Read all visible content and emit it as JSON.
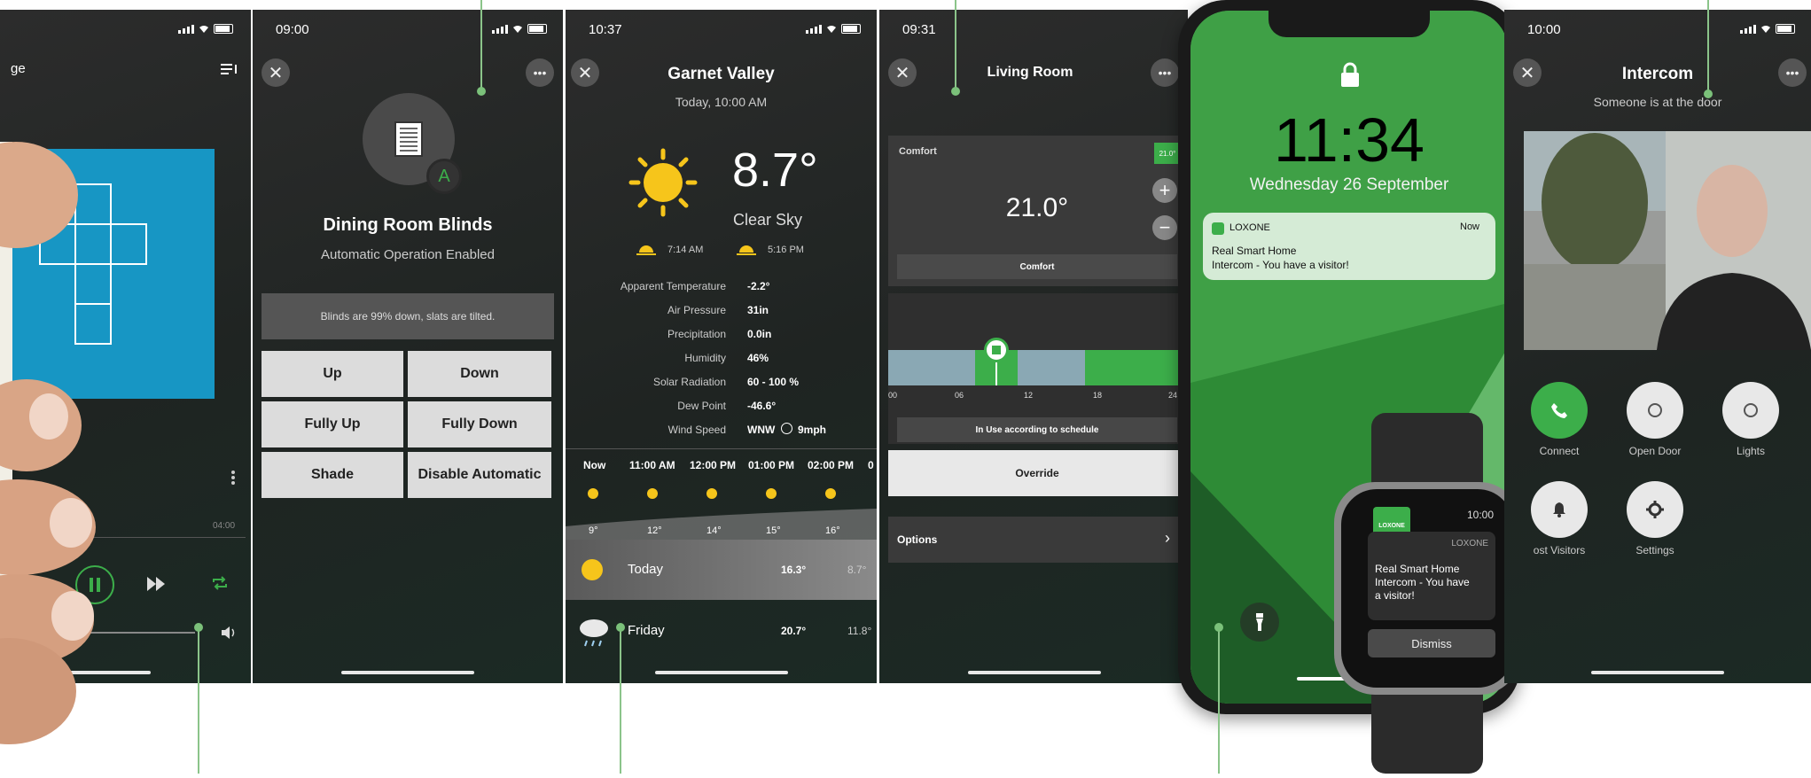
{
  "phone1": {
    "title_fragment": "ge",
    "duration": "04:00"
  },
  "phone2": {
    "time": "09:00",
    "title": "Dining Room Blinds",
    "subtitle": "Automatic Operation Enabled",
    "badge": "A",
    "status": "Blinds are 99% down, slats are tilted.",
    "buttons": [
      "Up",
      "Down",
      "Fully Up",
      "Fully Down",
      "Shade",
      "Disable Automatic"
    ]
  },
  "phone3": {
    "time": "10:37",
    "location": "Garnet Valley",
    "datetime": "Today, 10:00 AM",
    "temperature": "8.7°",
    "condition": "Clear Sky",
    "sunrise": "7:14 AM",
    "sunset": "5:16 PM",
    "details": [
      {
        "label": "Apparent Temperature",
        "value": "-2.2°"
      },
      {
        "label": "Air Pressure",
        "value": "31in"
      },
      {
        "label": "Precipitation",
        "value": "0.0in"
      },
      {
        "label": "Humidity",
        "value": "46%"
      },
      {
        "label": "Solar Radiation",
        "value": "60 - 100 %"
      },
      {
        "label": "Dew Point",
        "value": "-46.6°"
      },
      {
        "label": "Wind Speed",
        "value": "WNW",
        "extra": "9mph"
      }
    ],
    "hours": [
      "Now",
      "11:00 AM",
      "12:00 PM",
      "01:00 PM",
      "02:00 PM",
      "0"
    ],
    "hour_temps": [
      "9°",
      "12°",
      "14°",
      "15°",
      "16°"
    ],
    "days": [
      {
        "name": "Today",
        "high": "16.3°",
        "low": "8.7°"
      },
      {
        "name": "Friday",
        "high": "20.7°",
        "low": "11.8°"
      }
    ]
  },
  "phone4": {
    "time": "09:31",
    "title": "Living Room",
    "mode_label": "Comfort",
    "mode_badge": "21.0°",
    "setpoint": "21.0°",
    "mode_button": "Comfort",
    "axis": [
      "00",
      "06",
      "12",
      "18",
      "24"
    ],
    "schedule_text": "In Use according to schedule",
    "override": "Override",
    "options": "Options"
  },
  "phone5": {
    "clock": "11:34",
    "date": "Wednesday 26 September",
    "notif_app": "LOXONE",
    "notif_time": "Now",
    "notif_title": "Real Smart Home",
    "notif_body": "Intercom - You have a visitor!"
  },
  "watch": {
    "time": "10:00",
    "logo": "LOXONE",
    "app": "LOXONE",
    "message": "Real Smart Home Intercom - You have a visitor!",
    "dismiss": "Dismiss"
  },
  "phone6": {
    "time": "10:00",
    "title": "Intercom",
    "subtitle": "Someone is at the door",
    "buttons": [
      {
        "label": "Connect"
      },
      {
        "label": "Open Door"
      },
      {
        "label": "Lights"
      },
      {
        "label": "ost Visitors"
      },
      {
        "label": "Settings"
      }
    ]
  },
  "colors": {
    "accent": "#3cae4a",
    "loxone_green": "#6bc06f",
    "grey_button": "#dcdcdc",
    "music_blue": "#1796c4"
  }
}
